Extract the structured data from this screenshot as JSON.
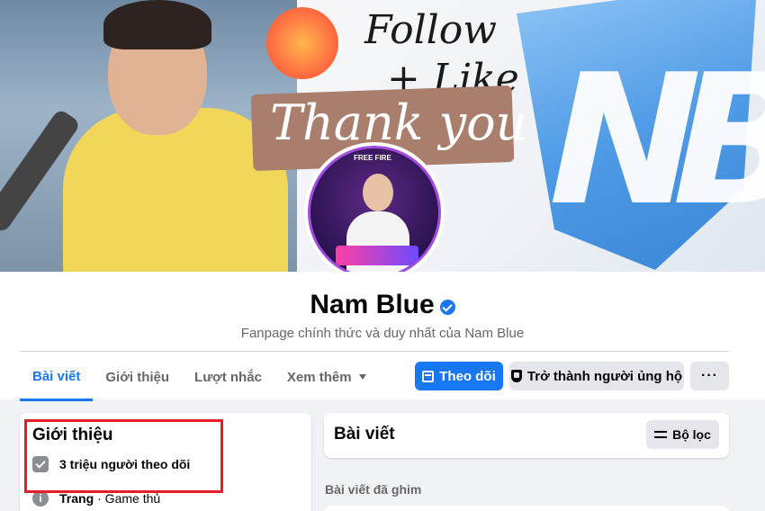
{
  "cover": {
    "follow_text": "Follow",
    "like_text": "+ Like",
    "thanks_text": "Thank you",
    "logo_text": "NB"
  },
  "avatar": {
    "top_text": "FREE FIRE"
  },
  "profile": {
    "name": "Nam Blue",
    "verified": true,
    "subtitle": "Fanpage chính thức và duy nhất của Nam Blue"
  },
  "tabs": [
    {
      "label": "Bài viết",
      "active": true
    },
    {
      "label": "Giới thiệu",
      "active": false
    },
    {
      "label": "Lượt nhắc",
      "active": false
    },
    {
      "label": "Xem thêm",
      "active": false
    }
  ],
  "actions": {
    "follow_label": "Theo dõi",
    "support_label": "Trở thành người ủng hộ",
    "more_label": "···"
  },
  "intro": {
    "title": "Giới thiệu",
    "followers": "3 triệu người theo dõi",
    "type_strong": "Trang",
    "type_rest": "· Game thủ"
  },
  "posts": {
    "title": "Bài viết",
    "filter_label": "Bộ lọc",
    "pinned_label": "Bài viết đã ghim"
  },
  "colors": {
    "accent": "#1877f2",
    "highlight_box": "#e41e26"
  }
}
